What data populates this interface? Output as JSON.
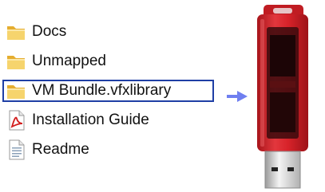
{
  "files": [
    {
      "name": "Docs",
      "icon": "folder-icon",
      "selected": false
    },
    {
      "name": "Unmapped",
      "icon": "folder-icon",
      "selected": false
    },
    {
      "name": "VM Bundle.vfxlibrary",
      "icon": "folder-icon",
      "selected": true
    },
    {
      "name": "Installation Guide",
      "icon": "pdf-icon",
      "selected": false
    },
    {
      "name": "Readme",
      "icon": "text-document-icon",
      "selected": false
    }
  ],
  "colors": {
    "selection_border": "#1f3fa5",
    "arrow": "#6f7ff0",
    "usb_body": "#d8232a",
    "folder": "#f3c85a"
  },
  "arrow_icon": "right-arrow-icon",
  "usb_icon": "usb-flash-drive-icon"
}
